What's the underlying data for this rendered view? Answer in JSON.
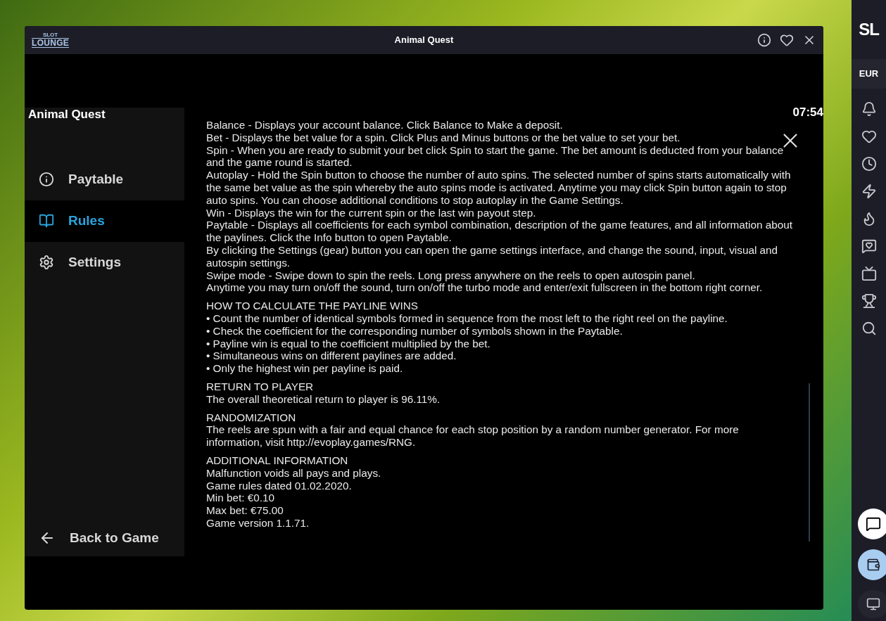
{
  "window": {
    "logo_small": "SLOT",
    "logo_main": "LOUNGE",
    "title": "Animal Quest"
  },
  "game_title": "Animal Quest",
  "clock": "07:54",
  "menu": [
    {
      "label": "Paytable",
      "kind": "info",
      "selected": false
    },
    {
      "label": "Rules",
      "kind": "book",
      "selected": true
    },
    {
      "label": "Settings",
      "kind": "gear",
      "selected": false
    }
  ],
  "back": "Back to Game",
  "rules": [
    {
      "lines": [
        "Balance - Displays your account balance. Click Balance to Make a deposit.",
        "Bet - Displays the bet value for a spin. Click Plus and Minus buttons or the bet value to set your bet.",
        "Spin - When you are ready to submit your bet click Spin to start the game. The bet amount is deducted from your balance and the game round is started.",
        "Autoplay - Hold the Spin button to choose the number of auto spins. The selected number of spins starts automatically with the same bet value as the spin whereby the auto spins mode is activated. Anytime you may click Spin button again to stop auto spins. You can choose additional conditions to stop autoplay in the Game Settings.",
        "Win - Displays the win for the current spin or the last win payout step.",
        "Paytable - Displays all coefficients for each symbol combination, description of the game features, and all information about the paylines. Click the Info button to open Paytable.",
        "By clicking the Settings (gear) button you can open the game settings interface, and change the sound, input, visual and autospin settings.",
        "Swipe mode - Swipe down to spin the reels. Long press anywhere on the reels to open autospin panel.",
        "Anytime you may turn on/off the sound, turn on/off the turbo mode and enter/exit fullscreen in the bottom right corner."
      ]
    },
    {
      "heading": "HOW TO CALCULATE THE PAYLINE WINS",
      "lines": [
        "• Count the number of identical symbols formed in sequence from the most left to the right reel on the payline.",
        "• Check the coefficient for the corresponding number of symbols shown in the Paytable.",
        "• Payline win is equal to the coefficient multiplied by the bet.",
        "• Simultaneous wins on different paylines are added.",
        "• Only the highest win per payline is paid."
      ]
    },
    {
      "heading": "RETURN TO PLAYER",
      "lines": [
        "The overall theoretical return to player is 96.11%."
      ]
    },
    {
      "heading": "RANDOMIZATION",
      "lines": [
        "The reels are spun with a fair and equal chance for each stop position by a random number generator. For more information, visit http://evoplay.games/RNG."
      ]
    },
    {
      "heading": "ADDITIONAL INFORMATION",
      "lines": [
        "Malfunction voids all pays and plays.",
        "Game rules dated 01.02.2020.",
        "Min bet: €0.10",
        "Max bet: €75.00",
        "Game version 1.1.71."
      ]
    }
  ],
  "site_sidebar": {
    "logo": "SL",
    "currency": "EUR"
  }
}
